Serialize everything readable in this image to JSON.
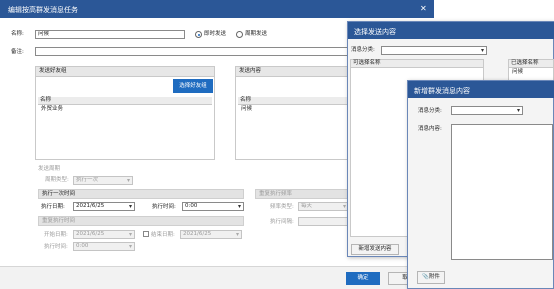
{
  "main": {
    "title": "编辑按高群发消息任务",
    "name_label": "名称:",
    "name_value": "问候",
    "send_now_label": "即时发送",
    "send_periodic_label": "周期发送",
    "remark_label": "备注:",
    "remark_value": "",
    "friends_group": {
      "header": "发送好友组",
      "select_button": "选择好友组",
      "column_name": "名称",
      "rows": [
        "外贸业务"
      ]
    },
    "content_group": {
      "header": "发送内容",
      "column_name": "名称",
      "rows": [
        "问候"
      ]
    },
    "cycle": {
      "label": "发送周期",
      "cycle_type_label": "周期类型:",
      "cycle_type_value": "执行一次",
      "once_header": "执行一次时间",
      "exec_date_label": "执行日期:",
      "exec_date_value": "2021/6/25",
      "exec_time_label": "执行时间:",
      "exec_time_value": "0:00",
      "repeat_freq_header": "重复执行频率",
      "freq_type_label": "频率类型:",
      "freq_type_value": "每天",
      "interval_label": "执行间隔:",
      "repeat_time_header": "重复执行时间",
      "start_date_label": "开始日期:",
      "start_date_value": "2021/6/25",
      "end_date_label": "结束日期:",
      "end_date_value": "2021/6/25",
      "repeat_exec_time_label": "执行时间:",
      "repeat_exec_time_value": "0:00"
    },
    "ok_button": "确定",
    "cancel_button": "取"
  },
  "select_dialog": {
    "title": "选择发送内容",
    "category_label": "消息分类:",
    "category_value": "",
    "left_column": "可选择名称",
    "right_column": "已选择名称",
    "right_rows": [
      "问候"
    ],
    "new_button": "新增发送内容"
  },
  "new_dialog": {
    "title": "新增群发消息内容",
    "category_label": "消息分类:",
    "category_value": "",
    "content_label": "消息内容:",
    "content_value": "",
    "attach_button": "附件"
  },
  "colors": {
    "titlebar": "#2b5797",
    "primary_button": "#1f6cc0"
  }
}
